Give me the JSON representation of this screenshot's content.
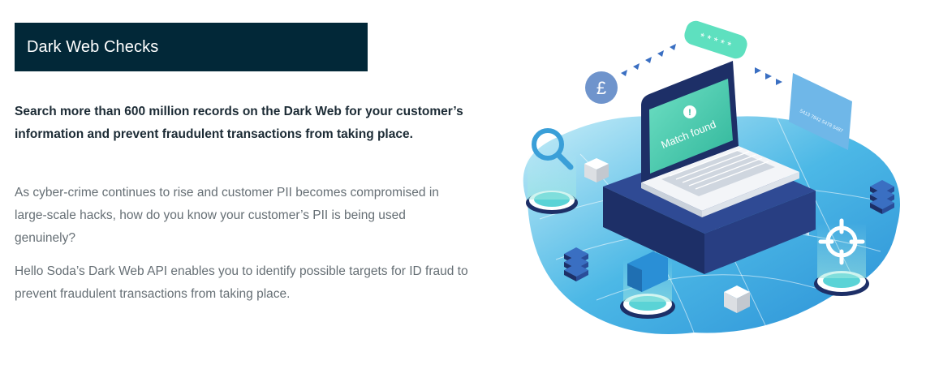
{
  "section": {
    "title": "Dark Web Checks",
    "lead": "Search more than 600 million records on the Dark Web for your customer’s information and prevent fraudulent transactions from taking place.",
    "paragraphs": [
      "As cyber-crime continues to rise and customer PII becomes compromised in large-scale hacks, how do you know your customer’s PII is being used genuinely?",
      "Hello Soda’s Dark Web API enables you to identify possible targets for ID fraud to prevent fraudulent transactions from taking place."
    ]
  },
  "illustration": {
    "alert_text": "Match found",
    "password_mask": "* * * * *",
    "currency_symbol": "£",
    "card_numbers": "5413  7842  5478  5487",
    "icons": [
      "laptop-icon",
      "magnifier-icon",
      "target-icon",
      "server-stack-icon",
      "folder-icon",
      "pound-coin-icon",
      "credit-card-icon",
      "password-bubble-icon",
      "cube-icon"
    ]
  },
  "colors": {
    "banner_bg": "#022838",
    "lead_text": "#1c2b35",
    "body_text": "#666f75",
    "accent_teal": "#3fd3b8",
    "accent_blue": "#2a8fd6",
    "laptop_navy": "#1d2f67"
  }
}
